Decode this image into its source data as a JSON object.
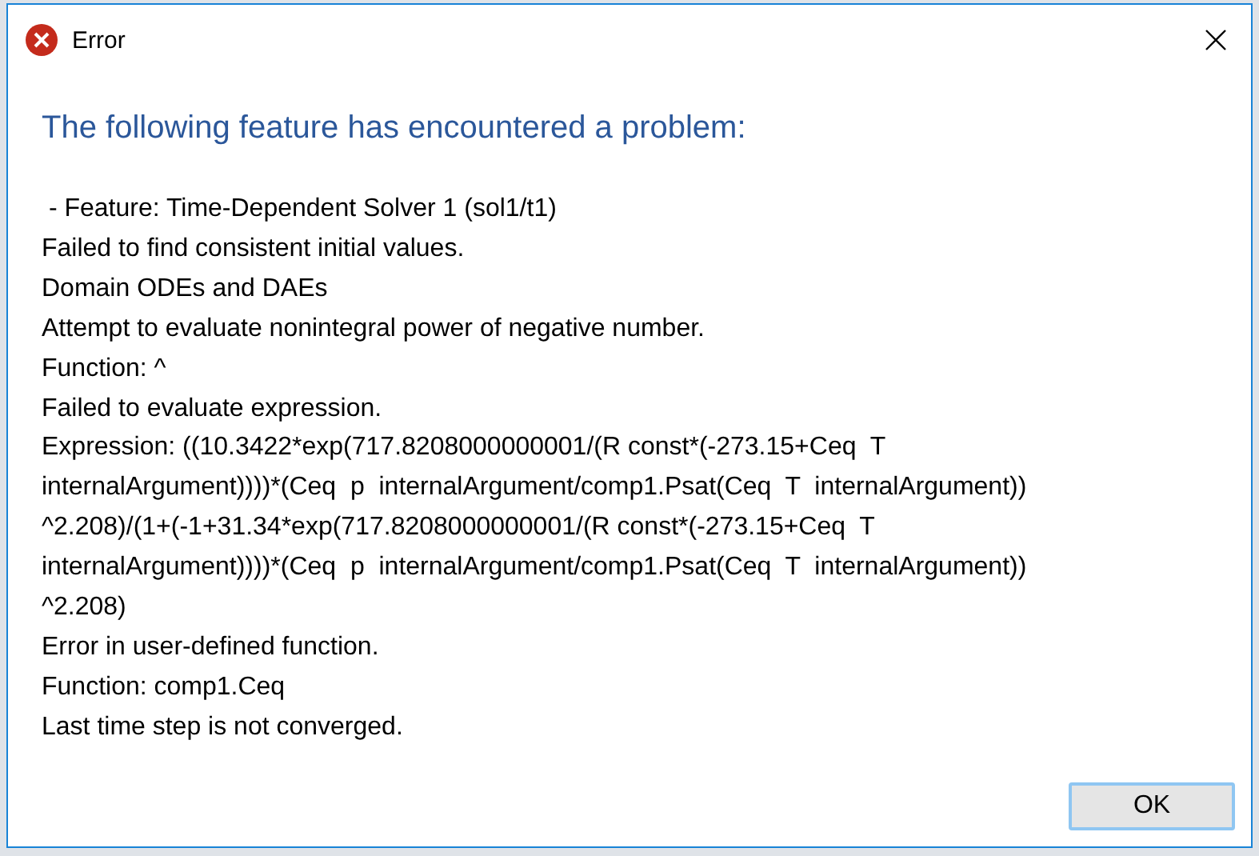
{
  "window": {
    "title": "Error"
  },
  "heading": "The following feature has encountered a problem:",
  "message_lines": [
    " - Feature: Time-Dependent Solver 1 (sol1/t1)",
    "Failed to find consistent initial values.",
    "Domain ODEs and DAEs",
    "Attempt to evaluate nonintegral power of negative number.",
    "Function: ^",
    "Failed to evaluate expression.",
    "Expression: ((10.3422*exp(717.8208000000001/(R const*(-273.15+Ceq  T",
    "internalArgument))))*(Ceq  p  internalArgument/comp1.Psat(Ceq  T  internalArgument))",
    "^2.208)/(1+(-1+31.34*exp(717.8208000000001/(R const*(-273.15+Ceq  T",
    "internalArgument))))*(Ceq  p  internalArgument/comp1.Psat(Ceq  T  internalArgument))",
    "^2.208)",
    "Error in user-defined function.",
    "Function: comp1.Ceq",
    "Last time step is not converged."
  ],
  "buttons": [
    "OK"
  ]
}
